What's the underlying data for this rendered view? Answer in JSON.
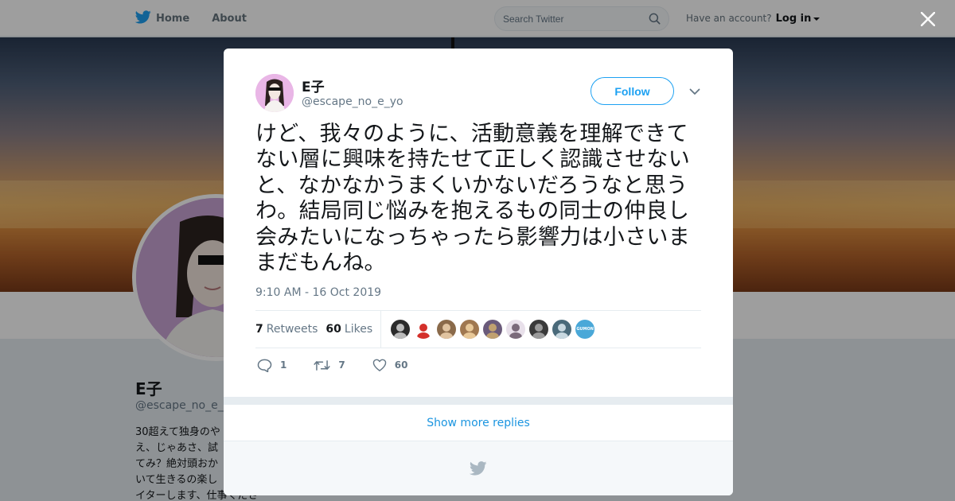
{
  "topbar": {
    "nav": [
      {
        "label": "Home",
        "icon": "twitter-bird-icon"
      },
      {
        "label": "About"
      }
    ],
    "search": {
      "placeholder": "Search Twitter"
    },
    "account": {
      "prompt": "Have an account?",
      "login_label": "Log in"
    }
  },
  "profile": {
    "name": "E子",
    "handle": "@escape_no_e_yo",
    "bio": "30超えて独身のや\nえ、じゃあさ、試\nてみ？絶対頭おか\nいて生きるの楽し\nイターします、仕事くださ"
  },
  "modal": {
    "close_icon": "close-icon",
    "tweet": {
      "fullname": "E子",
      "screen_name": "@escape_no_e_yo",
      "follow_label": "Follow",
      "text": "けど、我々のように、活動意義を理解できてない層に興味を持たせて正しく認識させないと、なかなかうまくいかないだろうなと思うわ。結局同じ悩みを抱えるもの同士の仲良し会みたいになっちゃったら影響力は小さいままだもんね。",
      "timestamp": "9:10 AM - 16 Oct 2019",
      "stats": {
        "retweets_count": "7",
        "retweets_label": "Retweets",
        "likes_count": "60",
        "likes_label": "Likes"
      },
      "liker_avatars": [
        {
          "bg": "#2b2b2b",
          "fg": "#bbbbbb"
        },
        {
          "bg": "#ffffff",
          "fg": "#d4302b"
        },
        {
          "bg": "#8a6a4a",
          "fg": "#e0c3a0"
        },
        {
          "bg": "#a07850",
          "fg": "#e8c898"
        },
        {
          "bg": "#6a5a7a",
          "fg": "#c0a070"
        },
        {
          "bg": "#e8e0ea",
          "fg": "#7a6a7a"
        },
        {
          "bg": "#3a3a3a",
          "fg": "#9a9a9a"
        },
        {
          "bg": "#4a6a7a",
          "fg": "#c8d8e0"
        },
        {
          "bg": "#4aa8d8",
          "fg": "#ffffff",
          "text": "GUMON"
        }
      ],
      "actions": [
        {
          "icon": "reply-icon",
          "count": "1"
        },
        {
          "icon": "retweet-icon",
          "count": "7"
        },
        {
          "icon": "heart-icon",
          "count": "60"
        }
      ]
    },
    "show_more_label": "Show more replies",
    "footer_icon": "twitter-bird-icon"
  },
  "colors": {
    "twitter_blue": "#1da1f2",
    "link_blue": "#1b95e0",
    "text_dark": "#14171a",
    "text_gray": "#657786"
  }
}
